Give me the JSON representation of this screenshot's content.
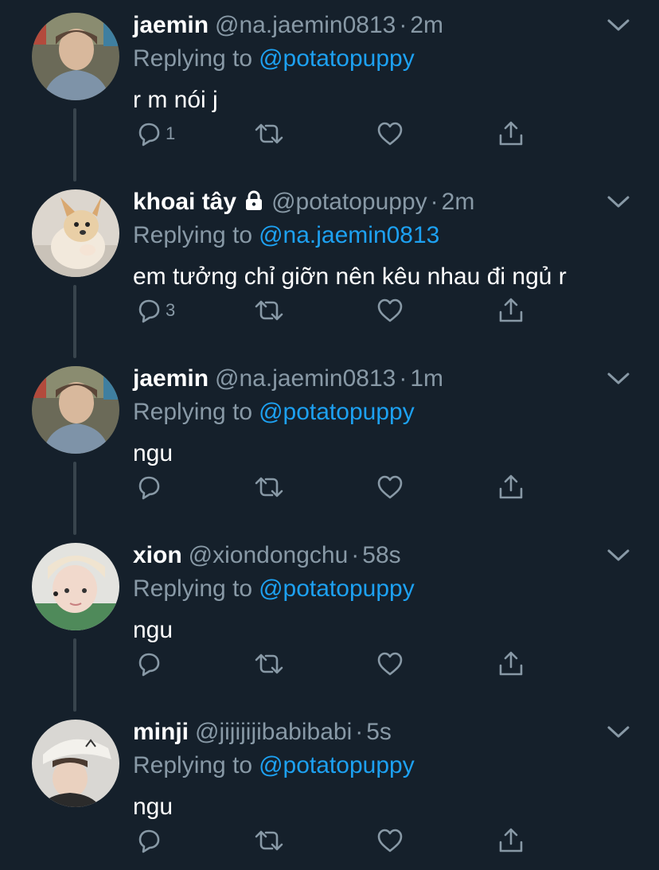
{
  "colors": {
    "background": "#15202b",
    "secondary_text": "#8899a6",
    "link": "#1da1f2",
    "thread_line": "#38444d"
  },
  "reply_prefix": "Replying to",
  "tweets": [
    {
      "name": "jaemin",
      "handle": "@na.jaemin0813",
      "separator": "·",
      "time": "2m",
      "reply_to": "@potatopuppy",
      "text": "r m nói j",
      "reply_count": "1",
      "protected": false,
      "avatar_icon": "avatar-photo-jaemin"
    },
    {
      "name": "khoai tây",
      "handle": "@potatopuppy",
      "separator": "·",
      "time": "2m",
      "reply_to": "@na.jaemin0813",
      "text": "em tưởng chỉ giỡn nên kêu nhau đi ngủ r",
      "reply_count": "3",
      "protected": true,
      "avatar_icon": "avatar-photo-dog"
    },
    {
      "name": "jaemin",
      "handle": "@na.jaemin0813",
      "separator": "·",
      "time": "1m",
      "reply_to": "@potatopuppy",
      "text": "ngu",
      "reply_count": "",
      "protected": false,
      "avatar_icon": "avatar-photo-jaemin"
    },
    {
      "name": "xion",
      "handle": "@xiondongchu",
      "separator": "·",
      "time": "58s",
      "reply_to": "@potatopuppy",
      "text": "ngu",
      "reply_count": "",
      "protected": false,
      "avatar_icon": "avatar-photo-xion"
    },
    {
      "name": "minji",
      "handle": "@jijijijibabibabi",
      "separator": "·",
      "time": "5s",
      "reply_to": "@potatopuppy",
      "text": "ngu",
      "reply_count": "",
      "protected": false,
      "avatar_icon": "avatar-photo-minji"
    }
  ]
}
